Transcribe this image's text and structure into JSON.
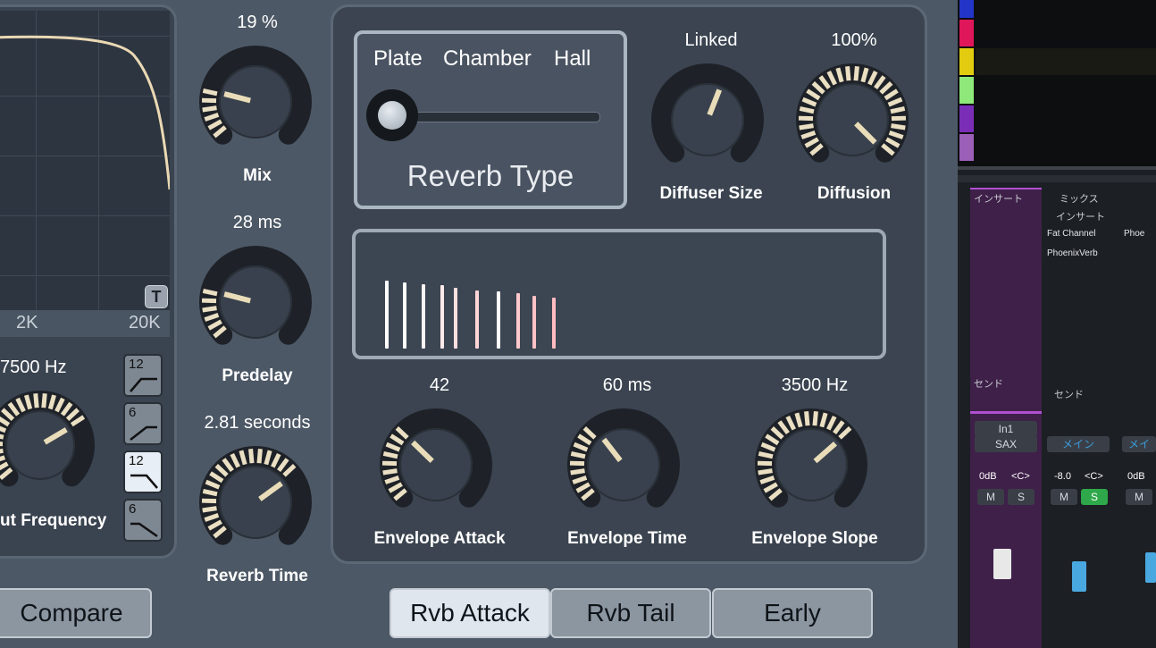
{
  "filter": {
    "freq_labels": [
      "2K",
      "20K"
    ],
    "t_button": "T",
    "cutoff_value": "7500 Hz",
    "cutoff_label": "ut Frequency",
    "cutoff_level": 0.72,
    "slopes": [
      "12",
      "6",
      "12",
      "6"
    ],
    "active_slope_index": 2
  },
  "mid_knobs": [
    {
      "value": "19 %",
      "label": "Mix",
      "level": 0.22
    },
    {
      "value": "28 ms",
      "label": "Predelay",
      "level": 0.22
    },
    {
      "value": "2.81 seconds",
      "label": "Reverb Time",
      "level": 0.7
    }
  ],
  "reverb_type": {
    "options": [
      "Plate",
      "Chamber",
      "Hall"
    ],
    "title": "Reverb Type",
    "selected": "Plate"
  },
  "diffuser": {
    "value": "Linked",
    "label": "Diffuser Size",
    "level": 0.58
  },
  "diffusion": {
    "value": "100%",
    "label": "Diffusion",
    "level": 1.0
  },
  "envelope_knobs": [
    {
      "value": "42",
      "label": "Envelope Attack",
      "level": 0.33
    },
    {
      "value": "60 ms",
      "label": "Envelope Time",
      "level": 0.36
    },
    {
      "value": "3500 Hz",
      "label": "Envelope Slope",
      "level": 0.68
    }
  ],
  "bottom_buttons": {
    "compare": "Compare",
    "tabs": [
      "Rvb Attack",
      "Rvb Tail",
      "Early"
    ],
    "selected_tab": "Rvb Attack"
  },
  "mixer": {
    "insert_label": "インサート",
    "mix_label": "ミックス",
    "send_label": "センド",
    "plugins": [
      "Fat Channel",
      "PhoenixVerb"
    ],
    "plugin_partial": "Phoe",
    "channel1": {
      "input": "In1",
      "name": "SAX",
      "level": "0dB",
      "pan": "<C>"
    },
    "channel2": {
      "output": "メイン",
      "level": "-8.0",
      "pan": "<C>"
    },
    "channel3": {
      "output": "メイ",
      "level": "0dB"
    },
    "mute": "M",
    "solo": "S",
    "scale": [
      "10",
      "6",
      "0",
      "-6",
      "-12",
      "-24",
      "-36",
      "-48"
    ],
    "colors": {
      "track_purple": "#5b2a6e",
      "solo_green": "#2ea84a",
      "accent_blue": "#3a9bd8"
    }
  },
  "colors": {
    "knob_ring": "#eadfc2",
    "panel": "#3b4450",
    "background": "#4d5866"
  }
}
